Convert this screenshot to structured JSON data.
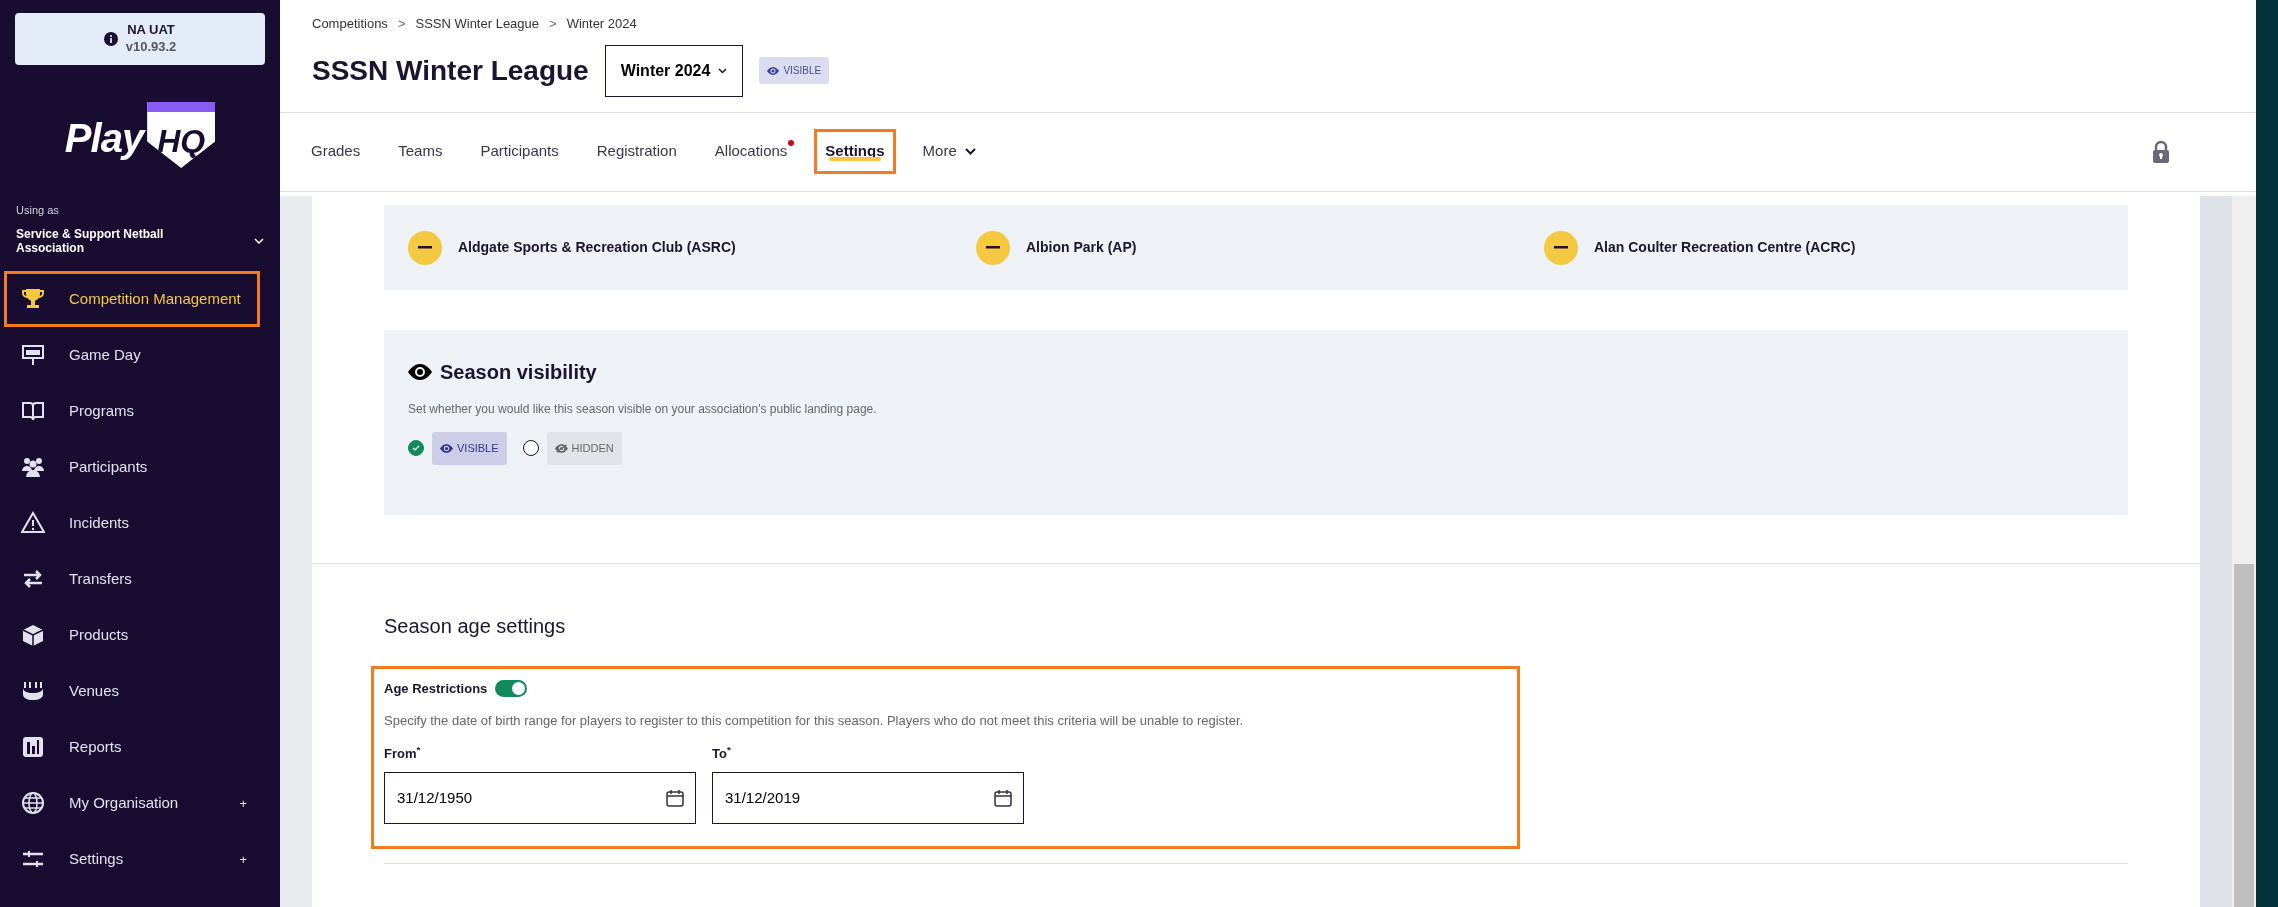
{
  "env_badge": {
    "name": "NA UAT",
    "version": "v10.93.2"
  },
  "logo": {
    "word": "Play",
    "badge": "HQ"
  },
  "org": {
    "label": "Using as",
    "name": "Service & Support Netball Association"
  },
  "nav": [
    {
      "label": "Competition Management",
      "selected": true,
      "highlighted": true
    },
    {
      "label": "Game Day",
      "selected": false,
      "highlighted": false
    },
    {
      "label": "Programs",
      "selected": false,
      "highlighted": false
    },
    {
      "label": "Participants",
      "selected": false,
      "highlighted": false
    },
    {
      "label": "Incidents",
      "selected": false,
      "highlighted": false
    },
    {
      "label": "Transfers",
      "selected": false,
      "highlighted": false
    },
    {
      "label": "Products",
      "selected": false,
      "highlighted": false
    },
    {
      "label": "Venues",
      "selected": false,
      "highlighted": false
    },
    {
      "label": "Reports",
      "selected": false,
      "highlighted": false
    },
    {
      "label": "My Organisation",
      "selected": false,
      "highlighted": false,
      "expander": "+"
    },
    {
      "label": "Settings",
      "selected": false,
      "highlighted": false,
      "expander": "+"
    }
  ],
  "breadcrumbs": [
    {
      "kind": "link",
      "text": "Competitions"
    },
    {
      "kind": "separator",
      "text": ">"
    },
    {
      "kind": "link",
      "text": "SSSN Winter League"
    },
    {
      "kind": "separator",
      "text": ">"
    },
    {
      "kind": "link",
      "text": "Winter 2024"
    }
  ],
  "title": "SSSN Winter League",
  "season_select": {
    "value": "Winter 2024"
  },
  "status_badge": "VISIBLE",
  "tabs": [
    {
      "label": "Grades",
      "selected": false,
      "highlighted": false,
      "notification": false
    },
    {
      "label": "Teams",
      "selected": false,
      "highlighted": false,
      "notification": false
    },
    {
      "label": "Participants",
      "selected": false,
      "highlighted": false,
      "notification": false
    },
    {
      "label": "Registration",
      "selected": false,
      "highlighted": false,
      "notification": false
    },
    {
      "label": "Allocations",
      "selected": false,
      "highlighted": false,
      "notification": true
    },
    {
      "label": "Settings",
      "selected": true,
      "highlighted": true,
      "notification": false
    },
    {
      "label": "More",
      "selected": false,
      "highlighted": false,
      "notification": false,
      "dropdown": true
    }
  ],
  "clubs": [
    "Aldgate Sports & Recreation Club (ASRC)",
    "Albion Park (AP)",
    "Alan Coulter Recreation Centre (ACRC)"
  ],
  "visibility": {
    "title": "Season visibility",
    "description": "Set whether you would like this season visible on your association's public landing page.",
    "options": [
      {
        "label": "VISIBLE",
        "selected": true
      },
      {
        "label": "HIDDEN",
        "selected": false
      }
    ]
  },
  "age_settings": {
    "title": "Season age settings",
    "highlighted": true,
    "restriction": {
      "label": "Age Restrictions",
      "on": true
    },
    "description": "Specify the date of birth range for players to register to this competition for this season. Players who do not meet this criteria will be unable to register.",
    "fields": [
      {
        "label": "From$^{*}$",
        "value": "31/12/1950"
      },
      {
        "label": "To$^{*}$",
        "value": "31/12/2019"
      }
    ]
  }
}
